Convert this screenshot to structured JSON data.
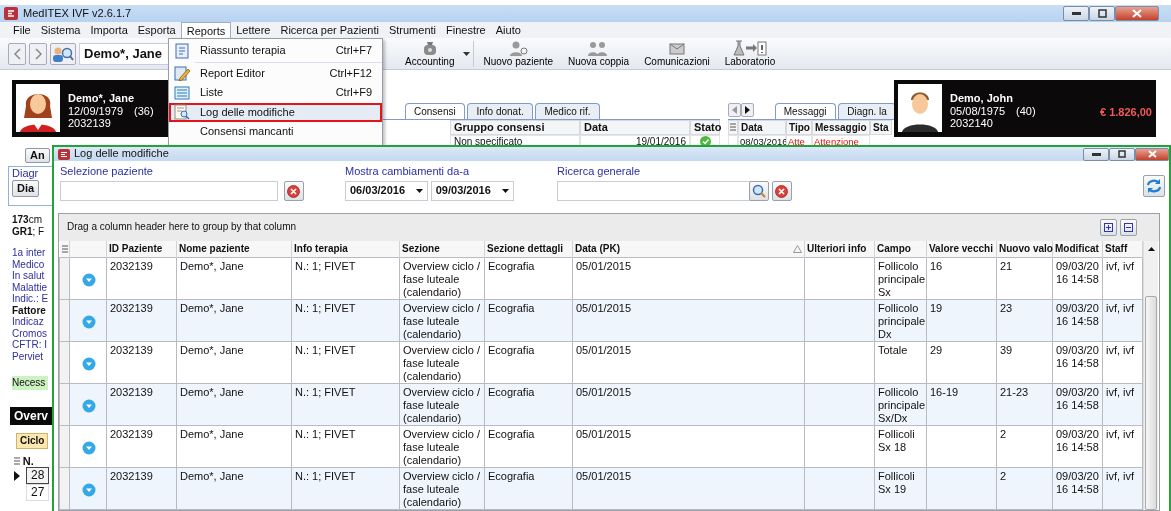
{
  "app": {
    "title": "MedITEX IVF v2.6.1.7"
  },
  "menu": [
    {
      "label": "File",
      "selected": false
    },
    {
      "label": "Sistema",
      "selected": false
    },
    {
      "label": "Importa",
      "selected": false
    },
    {
      "label": "Esporta",
      "selected": false
    },
    {
      "label": "Reports",
      "selected": true
    },
    {
      "label": "Lettere",
      "selected": false
    },
    {
      "label": "Ricerca per Pazienti",
      "selected": false
    },
    {
      "label": "Strumenti",
      "selected": false
    },
    {
      "label": "Finestre",
      "selected": false
    },
    {
      "label": "Aiuto",
      "selected": false
    }
  ],
  "toolbar": {
    "patient": "Demo*, Jane",
    "buttons": [
      {
        "label": "Accounting",
        "kind": "money"
      },
      {
        "label": "Nuovo paziente",
        "kind": "person"
      },
      {
        "label": "Nuova coppia",
        "kind": "couple"
      },
      {
        "label": "Comunicazioni",
        "kind": "mail"
      },
      {
        "label": "Laboratorio",
        "kind": "lab"
      }
    ]
  },
  "patient_cards": [
    {
      "kind": "female",
      "name": "Demo*, Jane",
      "birth": "12/09/1979",
      "age": "(36)",
      "id": "2032139"
    },
    {
      "kind": "male",
      "name": "Demo, John",
      "birth": "05/08/1975",
      "age": "(40)",
      "id": "2032140",
      "balance": "€ 1.826,00"
    }
  ],
  "consents": {
    "tabs": [
      {
        "label": "Consensi",
        "selected": true
      },
      {
        "label": "Info donat.",
        "selected": false
      },
      {
        "label": "Medico rif.",
        "selected": false
      }
    ],
    "columns": [
      "Gruppo consensi",
      "Data",
      "Stato"
    ],
    "rows": [
      {
        "cells": [
          "Non specificato",
          "19/01/2016"
        ]
      }
    ]
  },
  "messages": {
    "tabs": [
      {
        "label": "Messaggi",
        "selected": true
      },
      {
        "label": "Diagn. la",
        "selected": false
      }
    ],
    "columns": [
      "Data",
      "Tipo",
      "Messaggio",
      "Sta"
    ],
    "rows": [
      {
        "cells": [
          "08/03/2016",
          "Atte",
          "Attenzione"
        ]
      }
    ]
  },
  "sidebar": {
    "buttons": [
      "An"
    ],
    "group": "Diagr",
    "group_button": "Dia",
    "facts": [
      "**173**cm",
      "**GR1**; F"
    ],
    "items": [
      {
        "label": "1a inter",
        "kind": "link"
      },
      {
        "label": "Medico",
        "kind": "link"
      },
      {
        "label": "In salut",
        "kind": "link"
      },
      {
        "label": "Malattie",
        "kind": "link"
      },
      {
        "label": "Indic.: E",
        "kind": "link"
      },
      {
        "label": "Fattore",
        "kind": "bold"
      },
      {
        "label": "Indicaz",
        "kind": "link"
      },
      {
        "label": "Cromos",
        "kind": "link"
      },
      {
        "label": "CFTR: I",
        "kind": "link"
      },
      {
        "label": "Perviet",
        "kind": "link"
      },
      {
        "label": "Necess",
        "kind": "highlight"
      }
    ],
    "overview": {
      "title": "Overv",
      "tab": "Ciclo",
      "column": "N.",
      "rows": [
        {
          "label": "28",
          "selected": true
        },
        {
          "label": "27",
          "selected": false
        }
      ]
    }
  },
  "reports_menu": [
    {
      "label": "Riassunto terapia",
      "shortcut": "Ctrl+F7",
      "kind": "summary",
      "selected": false
    },
    {
      "label": "Report Editor",
      "shortcut": "Ctrl+F12",
      "kind": "editor",
      "selected": false
    },
    {
      "label": "Liste",
      "shortcut": "Ctrl+F9",
      "kind": "list",
      "selected": false
    },
    {
      "label": "Log delle modifiche",
      "kind": "log",
      "selected": true
    },
    {
      "label": "Consensi mancanti",
      "kind": "none",
      "selected": false
    }
  ],
  "log_window": {
    "title": "Log delle modifiche",
    "patient_label": "Selezione paziente",
    "date_label": "Mostra cambiamenti da-a",
    "date_from": "06/03/2016",
    "date_to": "09/03/2016",
    "search_label": "Ricerca generale",
    "group_hint": "Drag a column header here to group by that column",
    "columns": [
      {
        "label": "ID Paziente",
        "sorted": false
      },
      {
        "label": "Nome paziente",
        "sorted": false
      },
      {
        "label": "Info terapia",
        "sorted": false
      },
      {
        "label": "Sezione",
        "sorted": false
      },
      {
        "label": "Sezione dettagli",
        "sorted": false
      },
      {
        "label": "Data (PK)",
        "sorted": true
      },
      {
        "label": "Ulteriori info",
        "sorted": false
      },
      {
        "label": "Campo",
        "sorted": false
      },
      {
        "label": "Valore vecchi",
        "sorted": false
      },
      {
        "label": "Nuovo valo",
        "sorted": false
      },
      {
        "label": "Modificat",
        "sorted": false
      },
      {
        "label": "Staff",
        "sorted": false
      }
    ],
    "rows": [
      {
        "cells": [
          "2032139",
          "Demo*, Jane",
          "N.: 1;  FIVET",
          "Overview ciclo / fase luteale (calendario)",
          "Ecografia",
          "05/01/2015",
          "",
          "Follicolo principale Sx",
          "16",
          "21",
          "09/03/2016 14:58",
          "ivf, ivf"
        ]
      },
      {
        "cells": [
          "2032139",
          "Demo*, Jane",
          "N.: 1;  FIVET",
          "Overview ciclo / fase luteale (calendario)",
          "Ecografia",
          "05/01/2015",
          "",
          "Follicolo principale Dx",
          "19",
          "23",
          "09/03/2016 14:58",
          "ivf, ivf"
        ]
      },
      {
        "cells": [
          "2032139",
          "Demo*, Jane",
          "N.: 1;  FIVET",
          "Overview ciclo / fase luteale (calendario)",
          "Ecografia",
          "05/01/2015",
          "",
          "Totale",
          "29",
          "39",
          "09/03/2016 14:58",
          "ivf, ivf"
        ]
      },
      {
        "cells": [
          "2032139",
          "Demo*, Jane",
          "N.: 1;  FIVET",
          "Overview ciclo / fase luteale (calendario)",
          "Ecografia",
          "05/01/2015",
          "",
          "Follicolo principale Sx/Dx",
          "16-19",
          "21-23",
          "09/03/2016 14:58",
          "ivf, ivf"
        ]
      },
      {
        "cells": [
          "2032139",
          "Demo*, Jane",
          "N.: 1;  FIVET",
          "Overview ciclo / fase luteale (calendario)",
          "Ecografia",
          "05/01/2015",
          "",
          "Follicoli Sx 18",
          "",
          "2",
          "09/03/2016 14:58",
          "ivf, ivf"
        ]
      },
      {
        "cells": [
          "2032139",
          "Demo*, Jane",
          "N.: 1;  FIVET",
          "Overview ciclo / fase luteale (calendario)",
          "Ecografia",
          "05/01/2015",
          "",
          "Follicoli Sx 19",
          "",
          "2",
          "09/03/2016 14:58",
          "ivf, ivf"
        ]
      }
    ]
  }
}
